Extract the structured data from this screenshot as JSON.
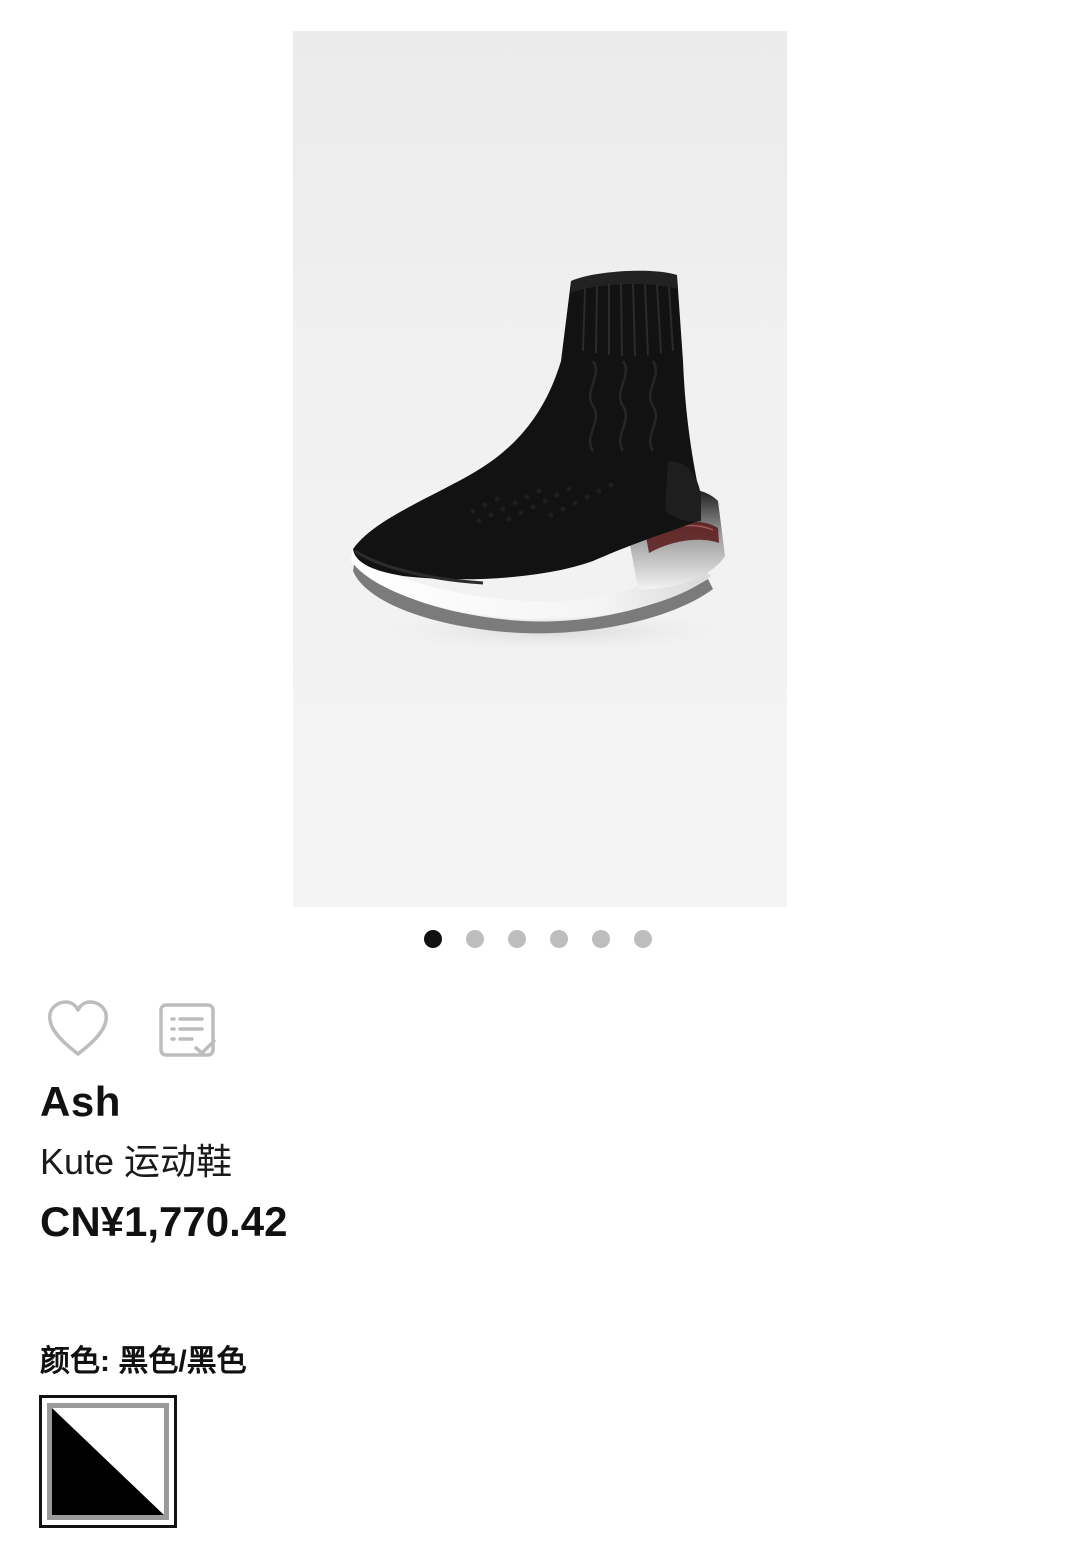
{
  "product": {
    "brand": "Ash",
    "name": "Kute 运动鞋",
    "price": "CN¥1,770.42"
  },
  "gallery": {
    "total_images": 6,
    "active_index": 0
  },
  "color": {
    "label": "颜色:",
    "value": "黑色/黑色",
    "swatch_colors": [
      "#000000",
      "#ffffff"
    ]
  },
  "icons": {
    "favorite": "heart-outline-icon",
    "list": "checklist-icon"
  }
}
